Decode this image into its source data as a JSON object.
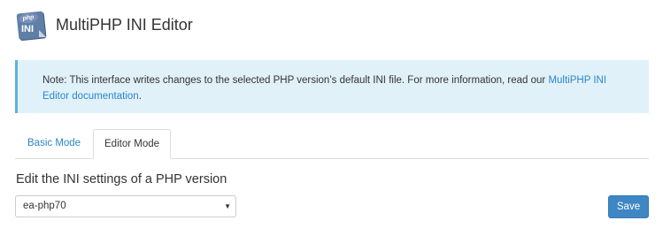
{
  "header": {
    "icon_name": "multiphp-ini-icon",
    "icon_badge_text": "php",
    "icon_text": "INI",
    "title": "MultiPHP INI Editor"
  },
  "note": {
    "text": "Note: This interface writes changes to the selected PHP version’s default INI file. For more information, read our ",
    "link_text": "MultiPHP INI Editor documentation",
    "trailing": "."
  },
  "tabs": [
    {
      "label": "Basic Mode",
      "active": false
    },
    {
      "label": "Editor Mode",
      "active": true
    }
  ],
  "form": {
    "section_label": "Edit the INI settings of a PHP version",
    "php_version_selected": "ea-php70",
    "save_label": "Save"
  },
  "colors": {
    "accent": "#2a86c9",
    "note_bg": "#e1f1fa",
    "note_border": "#5fb0e0",
    "save_bg": "#3f86c4"
  }
}
